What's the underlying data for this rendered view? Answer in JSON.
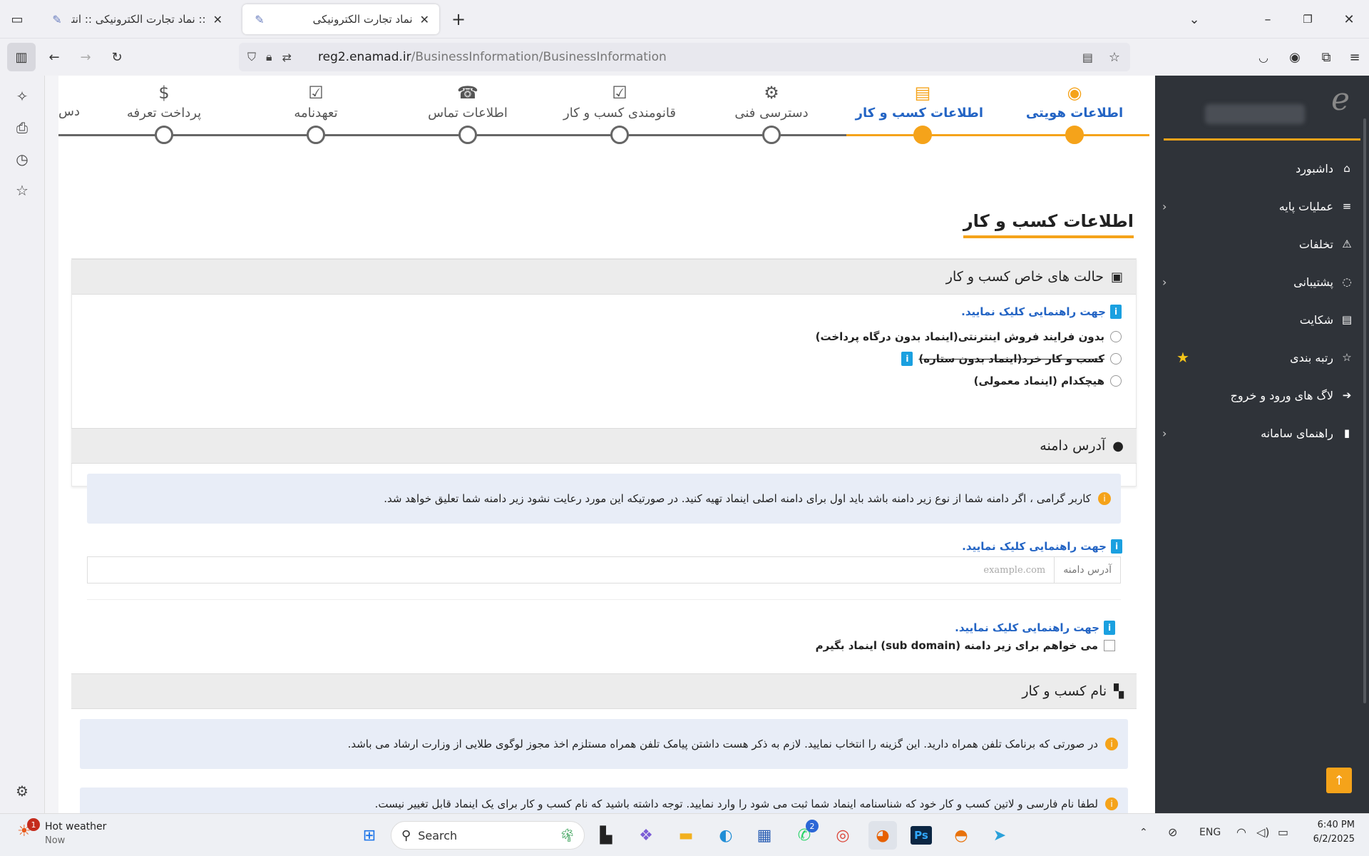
{
  "browser": {
    "tabs": [
      {
        "title": ":: نماد تجارت الکترونیکی :: انتخا",
        "active": false
      },
      {
        "title": "نماد تجارت الکترونیکی",
        "active": true
      }
    ],
    "new_tab": "+",
    "url_host": "reg2.enamad.ir",
    "url_path": "/BusinessInformation/BusinessInformation"
  },
  "steps": [
    {
      "label": "اطلاعات هویتی",
      "icon": "user-circle-icon",
      "state": "done"
    },
    {
      "label": "اطلاعات کسب و کار",
      "icon": "document-icon",
      "state": "done"
    },
    {
      "label": "دسترسی فنی",
      "icon": "gears-icon",
      "state": "pending"
    },
    {
      "label": "قانومندی کسب و کار",
      "icon": "check-square-icon",
      "state": "pending"
    },
    {
      "label": "اطلاعات تماس",
      "icon": "phone-icon",
      "state": "pending"
    },
    {
      "label": "تعهدنامه",
      "icon": "checklist-icon",
      "state": "pending"
    },
    {
      "label": "پرداخت تعرفه",
      "icon": "dollar-icon",
      "state": "pending"
    },
    {
      "label": "دس",
      "icon": "",
      "state": "pending"
    }
  ],
  "page_title": "اطلاعات کسب و کار",
  "special_states": {
    "heading": "حالت های خاص کسب و کار",
    "help": "جهت راهنمایی کلیک نمایید.",
    "options": [
      "بدون فرایند فروش اینترنتی(اینماد بدون درگاه پرداخت)",
      "کسب و کار خرد(اینماد بدون ستاره)",
      "هیچکدام (اینماد معمولی)"
    ]
  },
  "domain": {
    "heading": "آدرس دامنه",
    "notice": "کاربر گرامی ، اگر دامنه شما از نوع زیر دامنه باشد باید اول برای دامنه اصلی اینماد تهیه کنید. در صورتیکه این مورد رعایت نشود زیر دامنه شما تعلیق خواهد شد.",
    "help": "جهت راهنمایی کلیک نمایید.",
    "field_label": "آدرس دامنه",
    "field_placeholder": "example.com",
    "help2": "جهت راهنمایی کلیک نمایید.",
    "subdomain_checkbox": "می خواهم برای زیر دامنه (sub domain) اینماد بگیرم"
  },
  "business_name": {
    "heading": "نام کسب و کار",
    "notice": "در صورتی که برنامک تلفن همراه دارید. این گزینه را انتخاب نمایید. لازم به ذکر هست داشتن پیامک تلفن همراه مستلزم اخذ مجوز لوگوی طلایی از وزارت ارشاد می باشد.",
    "notice2": "لطفا نام فارسی و لاتین کسب و کار خود که شناسنامه اینماد شما ثبت می شود را وارد نمایید. توجه داشته باشید که نام کسب و کار برای یک اینماد قابل تغییر نیست."
  },
  "sidebar": {
    "items": [
      {
        "label": "داشبورد",
        "icon": "home-icon",
        "chevron": false
      },
      {
        "label": "عملیات پایه",
        "icon": "list-icon",
        "chevron": true
      },
      {
        "label": "تخلفات",
        "icon": "warning-icon",
        "chevron": false
      },
      {
        "label": "پشتیبانی",
        "icon": "chat-icon",
        "chevron": true
      },
      {
        "label": "شکایت",
        "icon": "file-icon",
        "chevron": false
      },
      {
        "label": "رتبه بندی",
        "icon": "star-icon",
        "chevron": false
      },
      {
        "label": "لاگ های ورود و خروج",
        "icon": "login-icon",
        "chevron": false
      },
      {
        "label": "راهنمای سامانه",
        "icon": "book-icon",
        "chevron": true
      }
    ]
  },
  "taskbar": {
    "weather_title": "Hot weather",
    "weather_sub": "Now",
    "weather_badge": "1",
    "search": "Search",
    "whatsapp_badge": "2",
    "lang": "ENG",
    "time": "6:40 PM",
    "date": "6/2/2025"
  },
  "colors": {
    "accent": "#f5a31a",
    "link": "#2364c4",
    "sidebar_bg": "#2f3339"
  }
}
